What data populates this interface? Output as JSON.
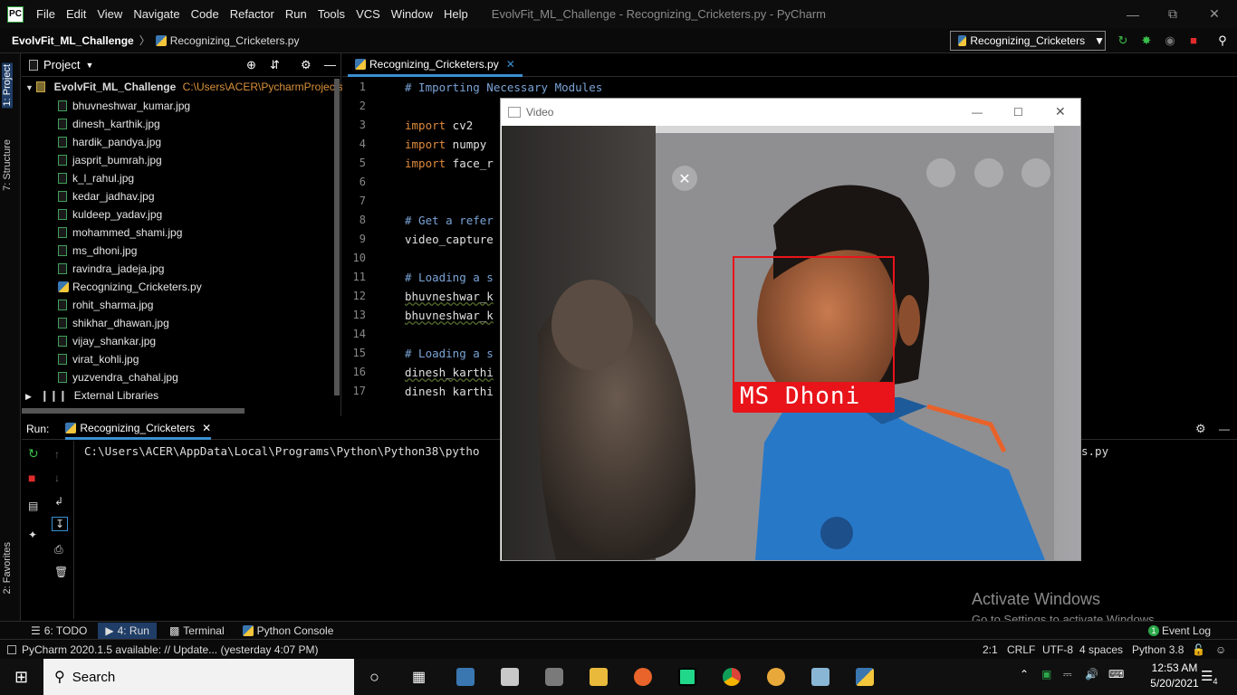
{
  "app": {
    "logo": "PC",
    "window_title": "EvolvFit_ML_Challenge - Recognizing_Cricketers.py - PyCharm",
    "menu": [
      "File",
      "Edit",
      "View",
      "Navigate",
      "Code",
      "Refactor",
      "Run",
      "Tools",
      "VCS",
      "Window",
      "Help"
    ]
  },
  "navbar": {
    "project": "EvolvFit_ML_Challenge",
    "file": "Recognizing_Cricketers.py",
    "run_config": "Recognizing_Cricketers"
  },
  "sidebar_tabs": {
    "project": "1: Project",
    "structure": "7: Structure",
    "favorites": "2: Favorites"
  },
  "project_panel": {
    "title": "Project",
    "root": "EvolvFit_ML_Challenge",
    "root_path": "C:\\Users\\ACER\\PycharmProjects\\",
    "files": [
      "bhuvneshwar_kumar.jpg",
      "dinesh_karthik.jpg",
      "hardik_pandya.jpg",
      "jasprit_bumrah.jpg",
      "k_l_rahul.jpg",
      "kedar_jadhav.jpg",
      "kuldeep_yadav.jpg",
      "mohammed_shami.jpg",
      "ms_dhoni.jpg",
      "ravindra_jadeja.jpg",
      "Recognizing_Cricketers.py",
      "rohit_sharma.jpg",
      "shikhar_dhawan.jpg",
      "vijay_shankar.jpg",
      "virat_kohli.jpg",
      "yuzvendra_chahal.jpg"
    ],
    "external": "External Libraries"
  },
  "editor": {
    "tab": "Recognizing_Cricketers.py",
    "line_numbers": [
      "1",
      "2",
      "3",
      "4",
      "5",
      "6",
      "7",
      "8",
      "9",
      "10",
      "11",
      "12",
      "13",
      "14",
      "15",
      "16",
      "17"
    ],
    "lines": [
      {
        "t": "# Importing Necessary Modules",
        "c": "cm"
      },
      {
        "t": "",
        "c": ""
      },
      {
        "t": "import cv2",
        "c": ""
      },
      {
        "t": "import numpy",
        "c": ""
      },
      {
        "t": "import face_r",
        "c": ""
      },
      {
        "t": "",
        "c": ""
      },
      {
        "t": "",
        "c": ""
      },
      {
        "t": "# Get a refer",
        "c": "cm"
      },
      {
        "t": "video_capture",
        "c": ""
      },
      {
        "t": "",
        "c": ""
      },
      {
        "t": "# Loading a s",
        "c": "cm"
      },
      {
        "t": "bhuvneshwar_k",
        "c": ""
      },
      {
        "t": "bhuvneshwar_k",
        "c": ""
      },
      {
        "t": "",
        "c": ""
      },
      {
        "t": "# Loading a s",
        "c": "cm"
      },
      {
        "t": "dinesh_karthi",
        "c": ""
      },
      {
        "t": "dinesh karthi",
        "c": ""
      }
    ]
  },
  "run_panel": {
    "label": "Run:",
    "tab": "Recognizing_Cricketers",
    "console_left": "C:\\Users\\ACER\\AppData\\Local\\Programs\\Python\\Python38\\pytho",
    "console_right": "s.py"
  },
  "video": {
    "title": "Video",
    "face_label": "MS Dhoni"
  },
  "bottom_tabs": {
    "todo": "6: TODO",
    "run": "4: Run",
    "terminal": "Terminal",
    "python_console": "Python Console",
    "event_log": "Event Log",
    "event_count": "1"
  },
  "status": {
    "message": "PyCharm 2020.1.5 available: // Update... (yesterday 4:07 PM)",
    "position": "2:1",
    "line_sep": "CRLF",
    "encoding": "UTF-8",
    "indent": "4 spaces",
    "interpreter": "Python 3.8"
  },
  "watermark": {
    "title": "Activate Windows",
    "subtitle": "Go to Settings to activate Windows."
  },
  "taskbar": {
    "search": "Search",
    "time": "12:53 AM",
    "date": "5/20/2021",
    "notifications": "4"
  }
}
